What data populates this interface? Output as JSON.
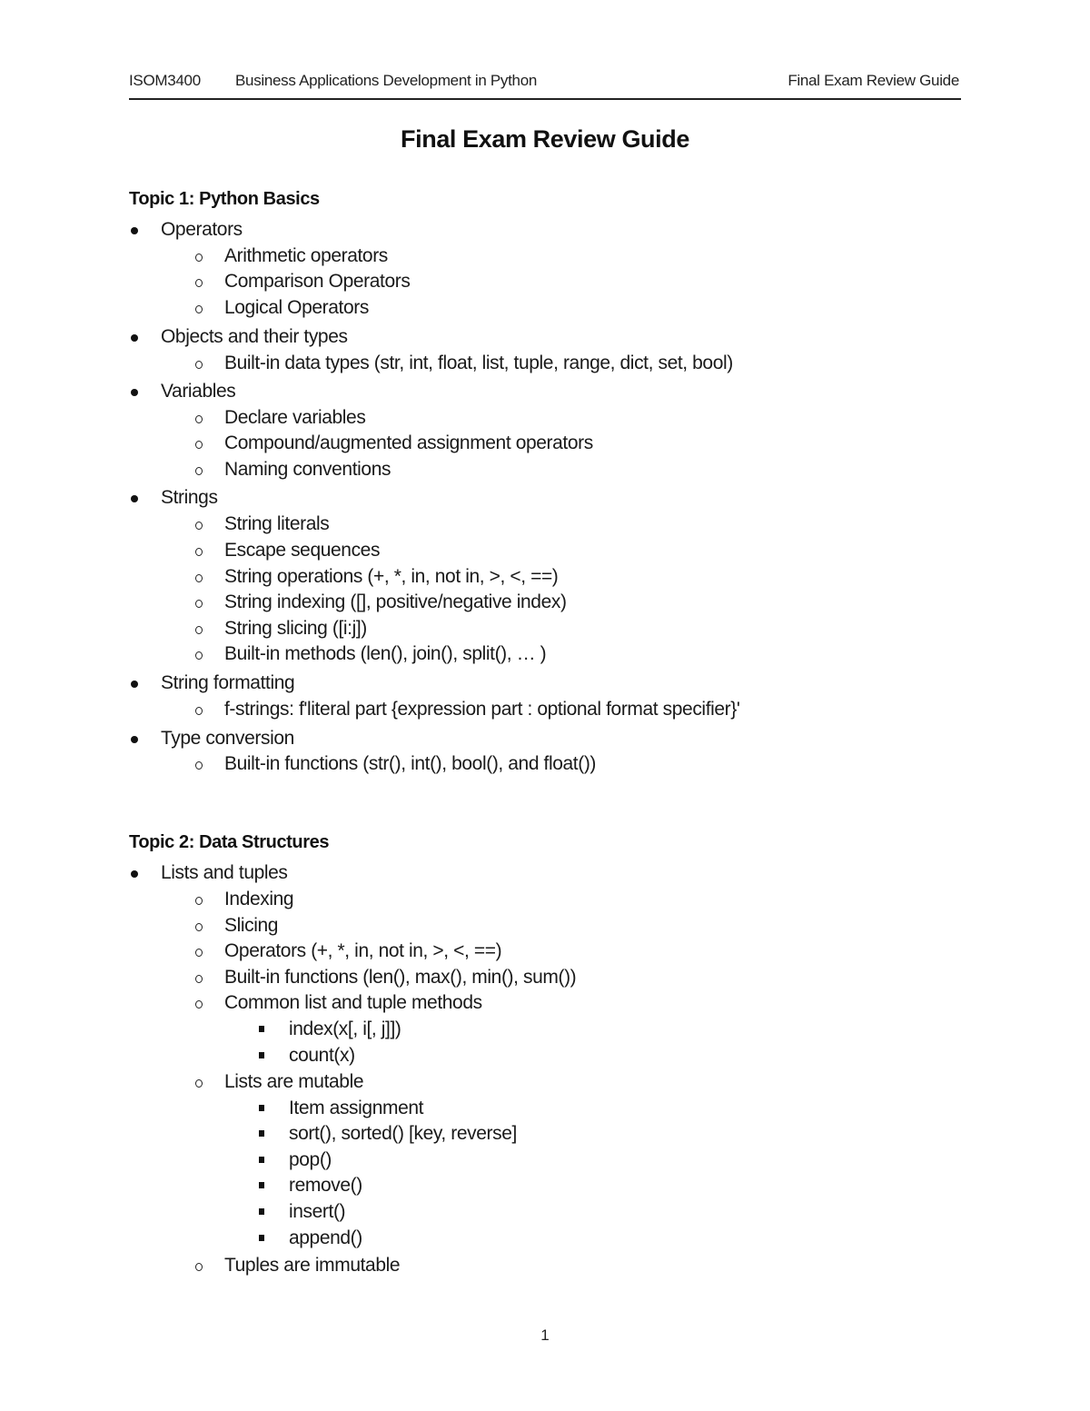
{
  "header": {
    "course_code": "ISOM3400",
    "course_name": "Business Applications Development in Python",
    "doc_label": "Final Exam Review Guide"
  },
  "title": "Final Exam Review Guide",
  "topics": [
    {
      "heading": "Topic 1: Python Basics",
      "items": [
        {
          "level": 1,
          "text": "Operators"
        },
        {
          "level": 2,
          "text": "Arithmetic operators"
        },
        {
          "level": 2,
          "text": "Comparison Operators"
        },
        {
          "level": 2,
          "text": "Logical Operators"
        },
        {
          "level": 1,
          "text": "Objects and their types"
        },
        {
          "level": 2,
          "text": "Built-in data types (str, int, float, list, tuple, range, dict, set, bool)"
        },
        {
          "level": 1,
          "text": "Variables"
        },
        {
          "level": 2,
          "text": "Declare variables"
        },
        {
          "level": 2,
          "text": "Compound/augmented assignment operators"
        },
        {
          "level": 2,
          "text": "Naming conventions"
        },
        {
          "level": 1,
          "text": "Strings"
        },
        {
          "level": 2,
          "text": "String literals"
        },
        {
          "level": 2,
          "text": "Escape sequences"
        },
        {
          "level": 2,
          "text": "String operations (+, *, in, not in, >, <, ==)"
        },
        {
          "level": 2,
          "text": "String indexing ([], positive/negative index)"
        },
        {
          "level": 2,
          "text": "String slicing ([i:j])"
        },
        {
          "level": 2,
          "text": "Built-in methods (len(), join(), split(), … )"
        },
        {
          "level": 1,
          "text": "String formatting"
        },
        {
          "level": 2,
          "text": "f-strings: f'literal part {expression part : optional format specifier}'"
        },
        {
          "level": 1,
          "text": "Type conversion"
        },
        {
          "level": 2,
          "text": "Built-in functions (str(), int(), bool(), and float())"
        }
      ]
    },
    {
      "heading": "Topic 2: Data Structures",
      "items": [
        {
          "level": 1,
          "text": "Lists and tuples"
        },
        {
          "level": 2,
          "text": "Indexing"
        },
        {
          "level": 2,
          "text": "Slicing"
        },
        {
          "level": 2,
          "text": "Operators (+, *, in, not in, >, <, ==)"
        },
        {
          "level": 2,
          "text": "Built-in functions (len(), max(), min(), sum())"
        },
        {
          "level": 2,
          "text": "Common list and tuple methods"
        },
        {
          "level": 3,
          "text": "index(x[, i[, j]])"
        },
        {
          "level": 3,
          "text": "count(x)"
        },
        {
          "level": 2,
          "text": "Lists are mutable"
        },
        {
          "level": 3,
          "text": "Item assignment"
        },
        {
          "level": 3,
          "text": "sort(), sorted() [key, reverse]"
        },
        {
          "level": 3,
          "text": "pop()"
        },
        {
          "level": 3,
          "text": "remove()"
        },
        {
          "level": 3,
          "text": "insert()"
        },
        {
          "level": 3,
          "text": "append()"
        },
        {
          "level": 2,
          "text": "Tuples are immutable"
        }
      ]
    }
  ],
  "page_number": "1"
}
